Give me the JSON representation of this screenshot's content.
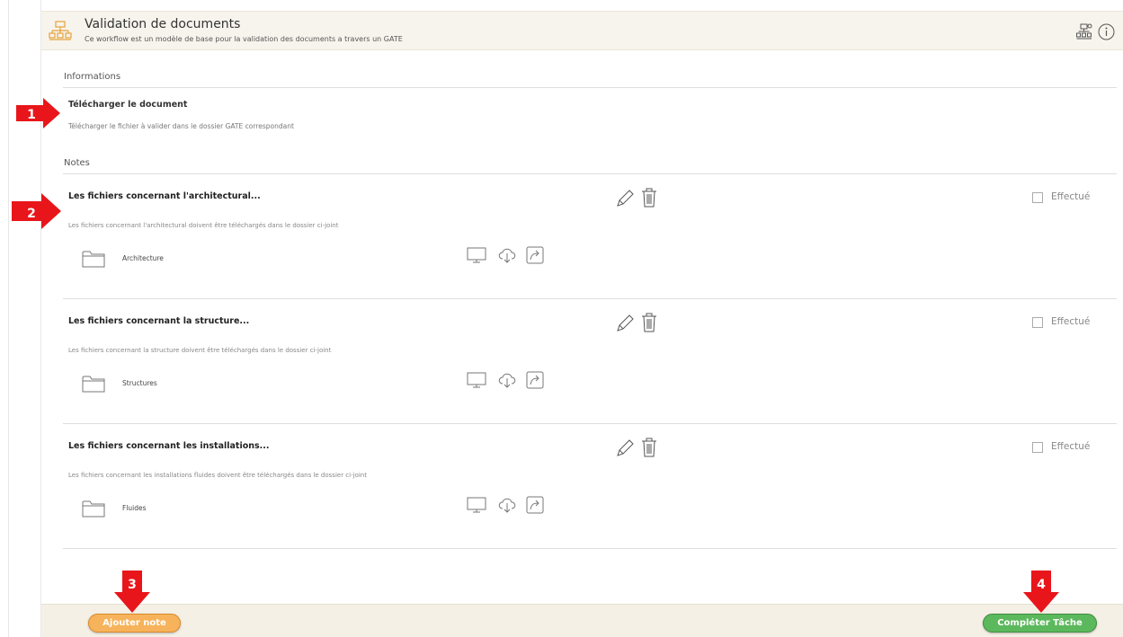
{
  "header": {
    "title": "Validation de documents",
    "subtitle": "Ce workflow est un modèle de base pour la validation des documents a travers un GATE"
  },
  "sections": {
    "informations": "Informations",
    "notes": "Notes"
  },
  "information": {
    "title": "Télécharger le document",
    "description": "Télécharger le fichier à valider dans le dossier GATE correspondant"
  },
  "notes": [
    {
      "title": "Les fichiers concernant l'architectural...",
      "description": "Les fichiers concernant l'architectural doivent être téléchargés dans le dossier ci-joint",
      "folder": "Architecture",
      "checkbox_label": "Effectué",
      "done": false
    },
    {
      "title": "Les fichiers concernant la structure...",
      "description": "Les fichiers concernant la structure doivent être téléchargés dans le dossier ci-joint",
      "folder": "Structures",
      "checkbox_label": "Effectué",
      "done": false
    },
    {
      "title": "Les fichiers concernant les installations...",
      "description": "Les fichiers concernant les installations fluides doivent être téléchargés dans le dossier ci-joint",
      "folder": "Fluides",
      "checkbox_label": "Effectué",
      "done": false
    }
  ],
  "footer": {
    "add_note_label": "Ajouter note",
    "complete_task_label": "Compléter Tâche"
  },
  "callouts": [
    "1",
    "2",
    "3",
    "4"
  ],
  "colors": {
    "callout": "#e8161b",
    "add_note": "#f7b35b",
    "complete_task": "#5cb85c",
    "workflow_icon": "#e6a23c"
  }
}
